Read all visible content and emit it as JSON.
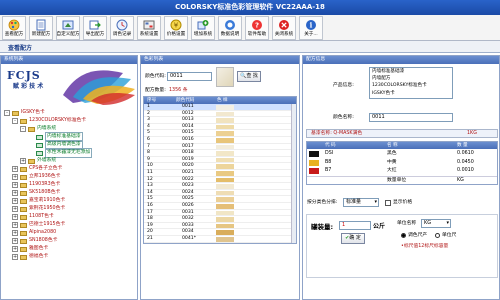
{
  "app": {
    "title": "COLORSKY标准色彩管理软件 VC22AAA-18"
  },
  "toolbar": {
    "buttons": [
      {
        "label": "查看配方",
        "icon": "palette-icon"
      },
      {
        "label": "新建配方",
        "icon": "new-doc-icon"
      },
      {
        "label": "自定义配方",
        "icon": "custom-recipe-icon"
      },
      {
        "label": "导出配方",
        "icon": "export-icon"
      },
      {
        "label": "调色记录",
        "icon": "record-icon"
      },
      {
        "label": "系统设置",
        "icon": "settings-icon"
      },
      {
        "label": "价格设置",
        "icon": "price-icon"
      },
      {
        "label": "增加系统",
        "icon": "add-system-icon"
      },
      {
        "label": "数据说明",
        "icon": "data-info-icon"
      },
      {
        "label": "软件帮助",
        "icon": "help-icon"
      },
      {
        "label": "关闭系统",
        "icon": "close-icon"
      },
      {
        "label": "关于...",
        "icon": "info-icon"
      }
    ]
  },
  "subbar": {
    "title": "查看配方"
  },
  "left": {
    "header": "系统列表",
    "logo": {
      "brand": "FCJS",
      "sub": "赋 彩 技 术"
    },
    "tree": [
      {
        "label": "IGSKY色卡",
        "level": 0,
        "exp": "-",
        "color": "red"
      },
      {
        "label": "1230COLORSKY标准色卡",
        "level": 1,
        "exp": "-",
        "color": "red"
      },
      {
        "label": "内墙系统",
        "level": 2,
        "exp": "-",
        "color": "green"
      },
      {
        "label": "内墙标准基础漆",
        "level": 3,
        "exp": "",
        "color": "green"
      },
      {
        "label": "高级内墙调色漆",
        "level": 3,
        "exp": "",
        "color": "green"
      },
      {
        "label": "水性木器漆无毛添加",
        "level": 3,
        "exp": "",
        "color": "green"
      },
      {
        "label": "外墙系统",
        "level": 2,
        "exp": "+",
        "color": "green"
      },
      {
        "label": "CPS各子立色卡",
        "level": 1,
        "exp": "+",
        "color": "red"
      },
      {
        "label": "立邦1936色卡",
        "level": 1,
        "exp": "+",
        "color": "red"
      },
      {
        "label": "11903R3色卡",
        "level": 1,
        "exp": "+",
        "color": "red"
      },
      {
        "label": "SK5180B色卡",
        "level": 1,
        "exp": "+",
        "color": "red"
      },
      {
        "label": "嘉宝莉1910色卡",
        "level": 1,
        "exp": "+",
        "color": "red"
      },
      {
        "label": "紫荆花1950色卡",
        "level": 1,
        "exp": "+",
        "color": "red"
      },
      {
        "label": "1108T色卡",
        "level": 1,
        "exp": "+",
        "color": "red"
      },
      {
        "label": "巴德士1915色卡",
        "level": 1,
        "exp": "+",
        "color": "red"
      },
      {
        "label": "Alpina2080",
        "level": 1,
        "exp": "+",
        "color": "red"
      },
      {
        "label": "SN1808色卡",
        "level": 1,
        "exp": "+",
        "color": "red"
      },
      {
        "label": "雅图色卡",
        "level": 1,
        "exp": "+",
        "color": "red"
      },
      {
        "label": "德福色卡",
        "level": 1,
        "exp": "+",
        "color": "red"
      }
    ]
  },
  "mid": {
    "header": "色彩列表",
    "search_label": "颜色代码:",
    "search_value": "0011",
    "search_button": "查 找",
    "count_label": "配方数量:",
    "count_value": "1356 条",
    "col_no": "序号",
    "col_code": "颜色代码",
    "col_swatch": "色 样",
    "rows": [
      {
        "code": "0011",
        "color": "#f3efe4"
      },
      {
        "code": "0012",
        "color": "#f2e8cf"
      },
      {
        "code": "0013",
        "color": "#f1e3bf"
      },
      {
        "code": "0014",
        "color": "#efdba8"
      },
      {
        "code": "0015",
        "color": "#ecd092"
      },
      {
        "code": "0016",
        "color": "#e8c57a"
      },
      {
        "code": "0017",
        "color": "#f3eddc"
      },
      {
        "code": "0018",
        "color": "#f2e7c8"
      },
      {
        "code": "0019",
        "color": "#f0dfb4"
      },
      {
        "code": "0020",
        "color": "#edd59c"
      },
      {
        "code": "0021",
        "color": "#e9c982"
      },
      {
        "code": "0022",
        "color": "#e4bd6a"
      },
      {
        "code": "0023",
        "color": "#f2e9d2"
      },
      {
        "code": "0024",
        "color": "#efddb4"
      },
      {
        "code": "0025",
        "color": "#ebcf96"
      },
      {
        "code": "0026",
        "color": "#e5bf78"
      },
      {
        "code": "0031",
        "color": "#f1e6c6"
      },
      {
        "code": "0032",
        "color": "#ecd7a4"
      },
      {
        "code": "0033",
        "color": "#e6c683"
      },
      {
        "code": "0034",
        "color": "#d9ad5b"
      },
      {
        "code": "0041*",
        "color": "#e0c48e"
      }
    ]
  },
  "right": {
    "header": "配方信息",
    "product_label": "产品信息:",
    "product_lines": [
      "内墙标准基础漆",
      "内墙配方",
      "1230COLORSKY标准色卡",
      "IGSKY色卡"
    ],
    "color_name_label": "颜色名称:",
    "color_name_value": "0011",
    "base_label": "基漆名称: Q-MASK满色",
    "base_volume": "1KG",
    "formula_cols": [
      "代 码",
      "名 称",
      "数 量"
    ],
    "formula_rows": [
      {
        "code": "DSI",
        "name": "黑色",
        "qty": "0.0610",
        "color": "#111111"
      },
      {
        "code": "B8",
        "name": "中黄",
        "qty": "0.0450",
        "color": "#e8b21f"
      },
      {
        "code": "B7",
        "name": "大红",
        "qty": "0.0010",
        "color": "#c81b1b"
      }
    ],
    "formula_footer_label": "数量单位",
    "formula_footer_value": "KG",
    "unit_label": "按分类色分排:",
    "unit_value": "标准量",
    "price_check": "显示价格",
    "can_label": "罐装量:",
    "can_value": "1",
    "can_unit": "公斤",
    "unit_sel_label": "单位名称",
    "unit_sel_value": "KG",
    "confirm": "确 定",
    "radio1": "调色尺产",
    "radio2": "单位尺",
    "note": "•标尺值12标尺标容量"
  }
}
